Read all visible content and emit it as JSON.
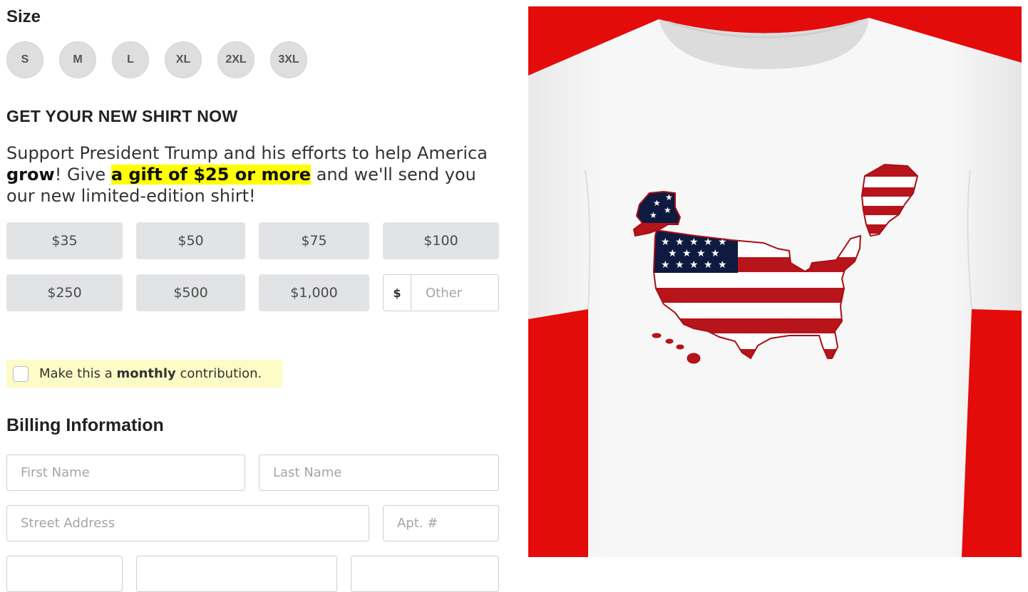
{
  "size": {
    "title": "Size",
    "options": [
      "S",
      "M",
      "L",
      "XL",
      "2XL",
      "3XL"
    ]
  },
  "headline": "GET YOUR NEW SHIRT NOW",
  "description": {
    "part1": "Support President Trump and his efforts to help America ",
    "bold": "grow",
    "part2": "! Give ",
    "highlight": "a gift of $25 or more",
    "part3": " and we'll send you our new limited-edition shirt!"
  },
  "amounts": [
    "$35",
    "$50",
    "$75",
    "$100",
    "$250",
    "$500",
    "$1,000"
  ],
  "other": {
    "currency": "$",
    "placeholder": "Other"
  },
  "monthly": {
    "pre": "Make this a ",
    "bold": "monthly",
    "post": " contribution."
  },
  "billing": {
    "title": "Billing Information",
    "first_name_placeholder": "First Name",
    "last_name_placeholder": "Last Name",
    "street_placeholder": "Street Address",
    "apt_placeholder": "Apt. #"
  },
  "colors": {
    "background_red": "#e40b0b",
    "highlight_yellow": "#ffff00",
    "monthly_bg": "#fdfbc6",
    "button_gray": "#e2e3e5",
    "flag_red": "#b8141b",
    "flag_blue": "#0e1a40"
  },
  "product_image": {
    "icon": "t-shirt-usa-flag-map"
  }
}
